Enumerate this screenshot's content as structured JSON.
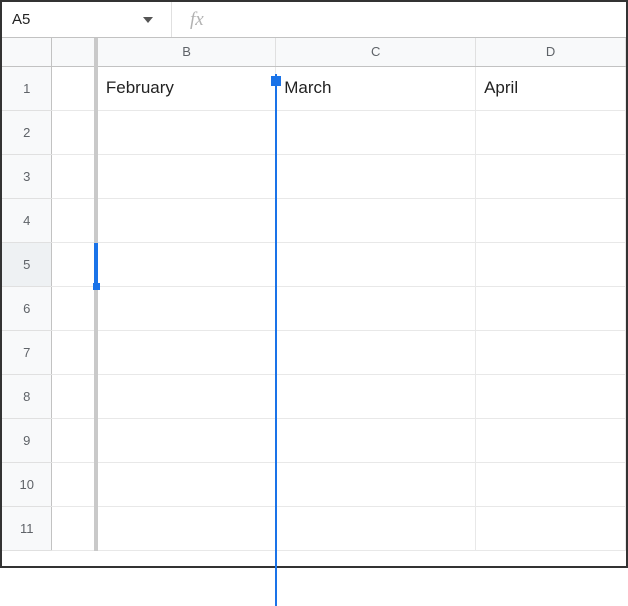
{
  "nameBox": {
    "value": "A5"
  },
  "formulaBar": {
    "fxLabel": "fx",
    "value": ""
  },
  "columns": {
    "B": "B",
    "C": "C",
    "D": "D"
  },
  "rows": [
    "1",
    "2",
    "3",
    "4",
    "5",
    "6",
    "7",
    "8",
    "9",
    "10",
    "11"
  ],
  "cells": {
    "B1": "February",
    "C1": "March",
    "D1": "April"
  },
  "selection": {
    "activeCell": "A5"
  },
  "colors": {
    "accent": "#1a73e8"
  }
}
